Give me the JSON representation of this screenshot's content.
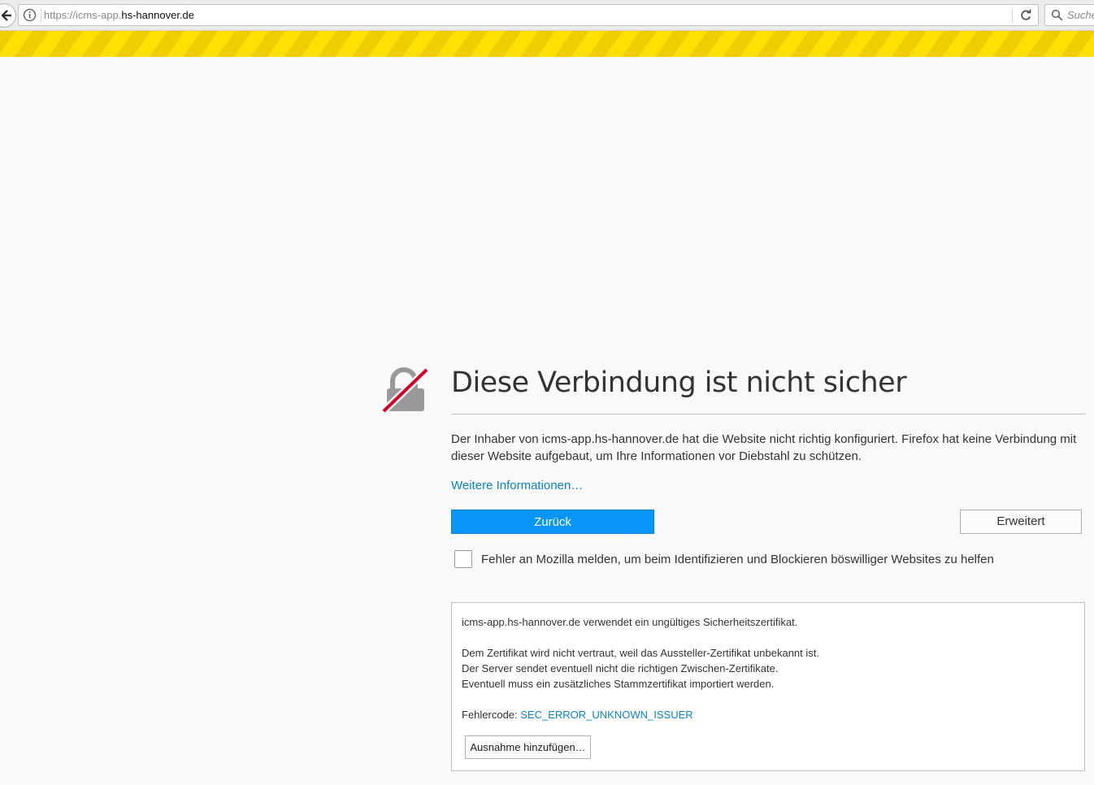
{
  "browser": {
    "url_prefix": "https://icms-app.",
    "url_host": "hs-hannover.de",
    "search_placeholder": "Suche"
  },
  "error": {
    "title": "Diese Verbindung ist nicht sicher",
    "description": "Der Inhaber von icms-app.hs-hannover.de hat die Website nicht richtig konfiguriert. Firefox hat keine Verbindung mit dieser Website aufgebaut, um Ihre Informationen vor Diebstahl zu schützen.",
    "more_info_link": "Weitere Informationen…",
    "back_button": "Zurück",
    "advanced_button": "Erweitert",
    "report_label": "Fehler an Mozilla melden, um beim Identifizieren und Blockieren böswilliger Websites zu helfen",
    "report_checked": false
  },
  "details": {
    "line1": "icms-app.hs-hannover.de verwendet ein ungültiges Sicherheitszertifikat.",
    "line2": "Dem Zertifikat wird nicht vertraut, weil das Aussteller-Zertifikat unbekannt ist.",
    "line3": "Der Server sendet eventuell nicht die richtigen Zwischen-Zertifikate.",
    "line4": "Eventuell muss ein zusätzliches Stammzertifikat importiert werden.",
    "error_code_label": "Fehlercode: ",
    "error_code": "SEC_ERROR_UNKNOWN_ISSUER",
    "exception_button": "Ausnahme hinzufügen…"
  },
  "icons": {
    "back": "arrow-left-icon",
    "info": "info-icon",
    "reload": "reload-icon",
    "search": "search-icon",
    "lock": "broken-lock-icon"
  },
  "colors": {
    "accent": "#0996f8",
    "link": "#0a84c6",
    "stripe_yellow": "#ffe000",
    "lock_slash": "#d70022"
  }
}
